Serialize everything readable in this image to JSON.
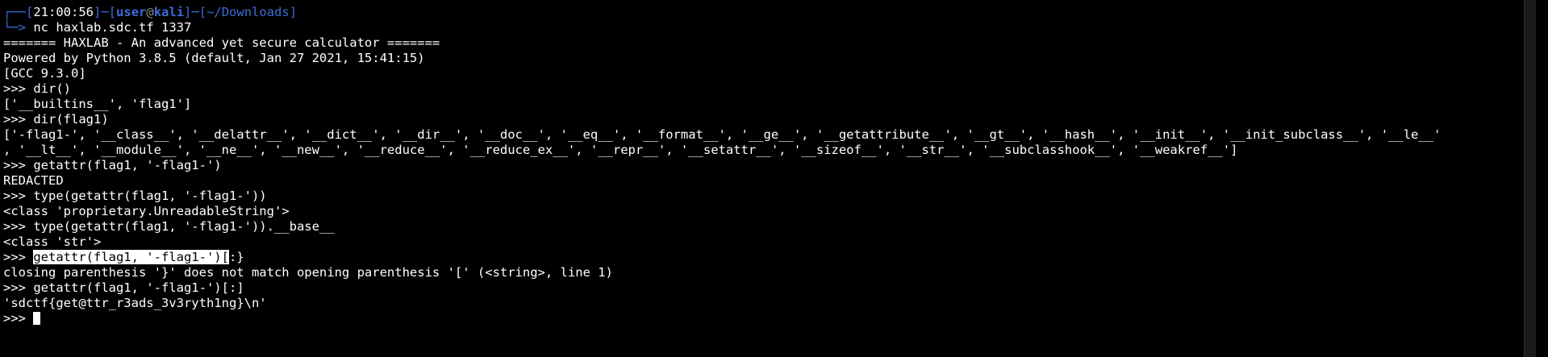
{
  "prompt": {
    "corner_top": "┌──",
    "bracket_open": "[",
    "time": "21:00:56",
    "bracket_close": "]",
    "separator": "─",
    "user": "user",
    "at": "@",
    "host": "kali",
    "path": "~/Downloads",
    "corner_bottom": "└─",
    "arrow": "> ",
    "command": "nc haxlab.sdc.tf 1337"
  },
  "output_lines": [
    "======= HAXLAB - An advanced yet secure calculator =======",
    "Powered by Python 3.8.5 (default, Jan 27 2021, 15:41:15)",
    "[GCC 9.3.0]",
    ">>> dir()",
    "['__builtins__', 'flag1']",
    ">>> dir(flag1)",
    "['-flag1-', '__class__', '__delattr__', '__dict__', '__dir__', '__doc__', '__eq__', '__format__', '__ge__', '__getattribute__', '__gt__', '__hash__', '__init__', '__init_subclass__', '__le__'",
    ", '__lt__', '__module__', '__ne__', '__new__', '__reduce__', '__reduce_ex__', '__repr__', '__setattr__', '__sizeof__', '__str__', '__subclasshook__', '__weakref__']",
    ">>> getattr(flag1, '-flag1-')",
    "REDACTED",
    ">>> type(getattr(flag1, '-flag1-'))",
    "<class 'proprietary.UnreadableString'>",
    ">>> type(getattr(flag1, '-flag1-')).__base__",
    "<class 'str'>"
  ],
  "selection_line": {
    "prefix": ">>> ",
    "selected": "getattr(flag1, '-flag1-')[",
    "rest": ":}"
  },
  "output_lines_2": [
    "closing parenthesis '}' does not match opening parenthesis '[' (<string>, line 1)",
    ">>> getattr(flag1, '-flag1-')[:]",
    "'sdctf{get@ttr_r3ads_3v3ryth1ng}\\n'"
  ],
  "input_prompt": ">>> ",
  "colors": {
    "background": "#000000",
    "text": "#ffffff",
    "accent_blue": "#3b6cd8"
  }
}
